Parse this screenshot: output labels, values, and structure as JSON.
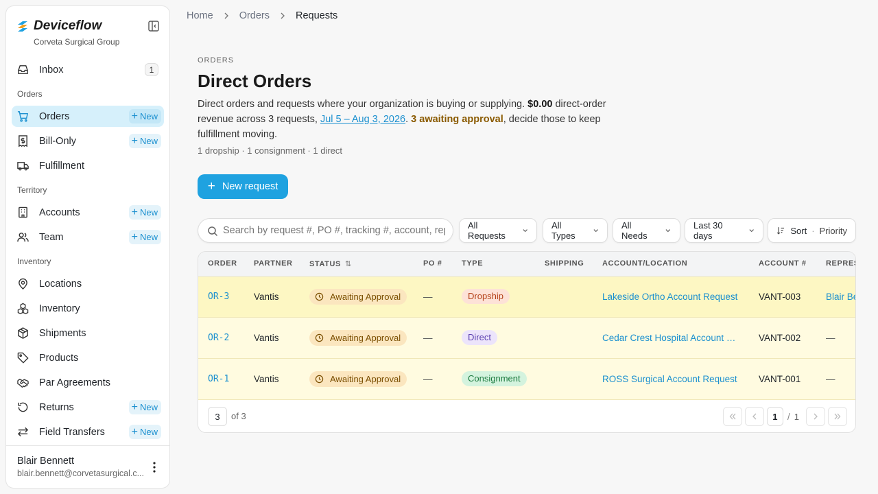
{
  "brand": {
    "name": "Deviceflow",
    "org": "Corveta Surgical Group"
  },
  "sidebar": {
    "inbox": {
      "label": "Inbox",
      "count": "1"
    },
    "sections": {
      "orders": "Orders",
      "territory": "Territory",
      "inventory": "Inventory"
    },
    "items": {
      "orders": "Orders",
      "bill_only": "Bill-Only",
      "fulfillment": "Fulfillment",
      "accounts": "Accounts",
      "team": "Team",
      "locations": "Locations",
      "inventory": "Inventory",
      "shipments": "Shipments",
      "products": "Products",
      "par_agreements": "Par Agreements",
      "returns": "Returns",
      "field_transfers": "Field Transfers"
    },
    "new_label": "New"
  },
  "user": {
    "name": "Blair Bennett",
    "email": "blair.bennett@corvetasurgical.c..."
  },
  "breadcrumb": [
    "Home",
    "Orders",
    "Requests"
  ],
  "header": {
    "eyebrow": "ORDERS",
    "title": "Direct Orders",
    "desc_1": "Direct orders and requests where your organization is buying or supplying. ",
    "revenue": "$0.00",
    "desc_2": " direct-order revenue across 3 requests, ",
    "date_range": "Jul 5 – Aug 3, 2026",
    "desc_3": ". ",
    "awaiting": "3 awaiting approval",
    "desc_4": ", decide those to keep fulfillment moving.",
    "counts": "1 dropship · 1 consignment · 1 direct"
  },
  "new_request_label": "New request",
  "search": {
    "placeholder": "Search by request #, PO #, tracking #, account, rep, ..."
  },
  "filters": {
    "requests": "All Requests",
    "types": "All Types",
    "needs": "All Needs",
    "period": "Last 30 days",
    "sort_label": "Sort",
    "sort_value": "Priority"
  },
  "table": {
    "columns": [
      "ORDER",
      "PARTNER",
      "STATUS",
      "PO #",
      "TYPE",
      "SHIPPING",
      "ACCOUNT/LOCATION",
      "ACCOUNT #",
      "REPRESENTATIVE"
    ],
    "rows": [
      {
        "order": "OR-3",
        "partner": "Vantis",
        "status": "Awaiting Approval",
        "po": "—",
        "type": "Dropship",
        "shipping": "",
        "account": "Lakeside Ortho Account Request",
        "account_no": "VANT-003",
        "rep": "Blair Bennett"
      },
      {
        "order": "OR-2",
        "partner": "Vantis",
        "status": "Awaiting Approval",
        "po": "—",
        "type": "Direct",
        "shipping": "",
        "account": "Cedar Crest Hospital Account Request",
        "account_no": "VANT-002",
        "rep": "—"
      },
      {
        "order": "OR-1",
        "partner": "Vantis",
        "status": "Awaiting Approval",
        "po": "—",
        "type": "Consignment",
        "shipping": "",
        "account": "ROSS Surgical Account Request",
        "account_no": "VANT-001",
        "rep": "—"
      }
    ]
  },
  "pagination": {
    "page_size": "3",
    "of_label": "of 3",
    "current": "1",
    "slash": "/",
    "total": "1"
  }
}
